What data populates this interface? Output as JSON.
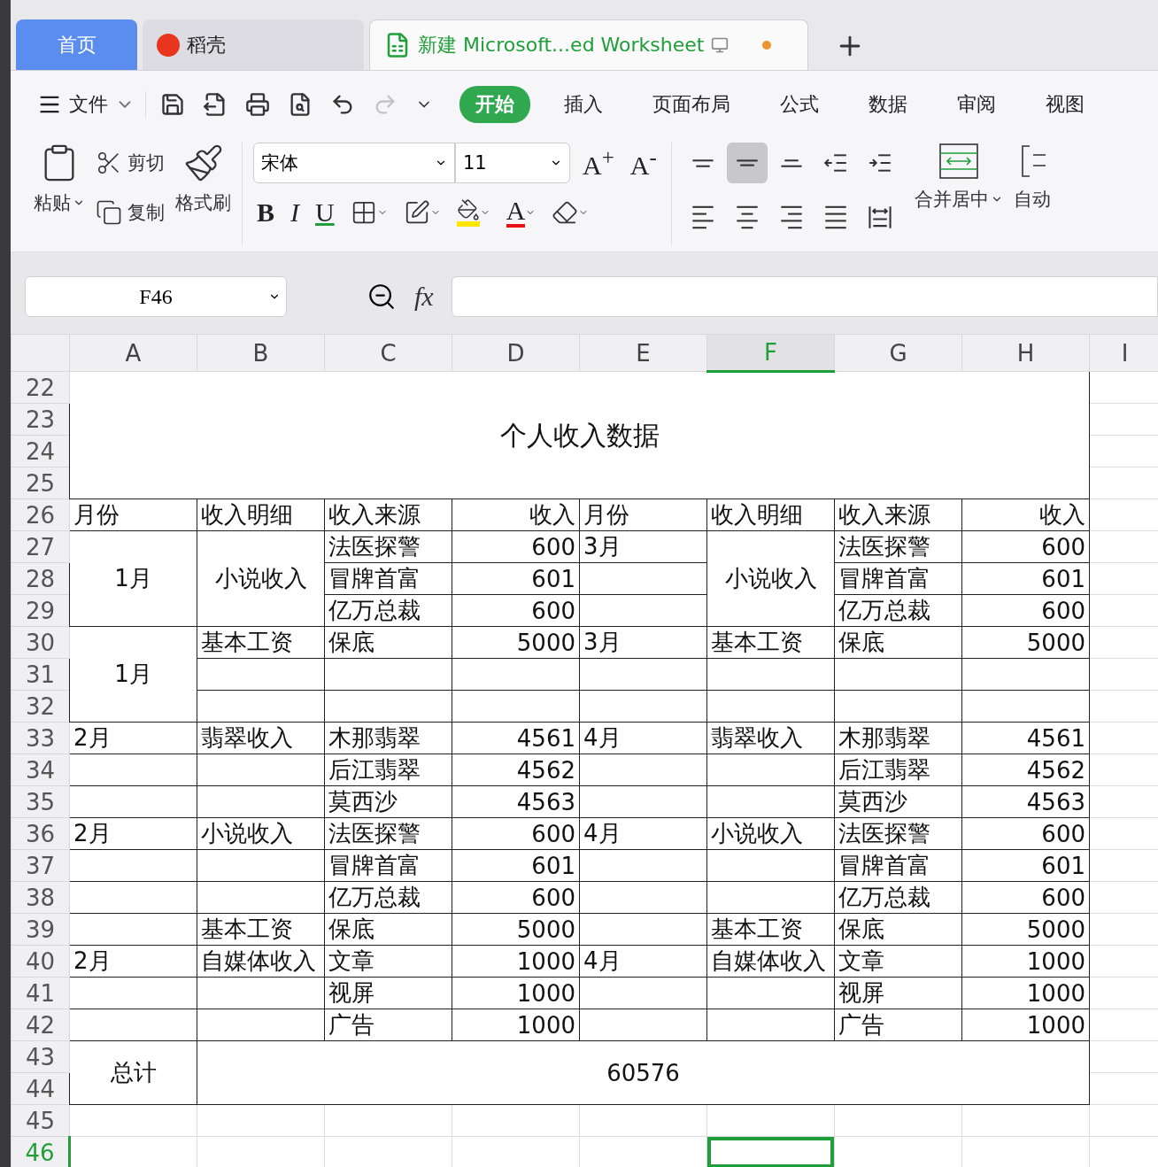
{
  "tabs": [
    {
      "label": "首页",
      "kind": "home",
      "selected": false
    },
    {
      "label": "稻壳",
      "kind": "docer",
      "selected": false
    },
    {
      "label": "新建 Microsoft...ed Worksheet",
      "kind": "sheet",
      "selected": true,
      "unsaved": true
    }
  ],
  "menu": {
    "file": "文件",
    "quick_access": [
      {
        "kind": "save",
        "disabled": false
      },
      {
        "kind": "export",
        "disabled": false
      },
      {
        "kind": "print",
        "disabled": false
      },
      {
        "kind": "preview",
        "disabled": false
      },
      {
        "kind": "undo",
        "disabled": false
      },
      {
        "kind": "redo",
        "disabled": true
      },
      {
        "kind": "more",
        "disabled": false
      }
    ],
    "tabs": [
      {
        "label": "开始",
        "selected": true
      },
      {
        "label": "插入",
        "selected": false
      },
      {
        "label": "页面布局",
        "selected": false
      },
      {
        "label": "公式",
        "selected": false
      },
      {
        "label": "数据",
        "selected": false
      },
      {
        "label": "审阅",
        "selected": false
      },
      {
        "label": "视图",
        "selected": false
      }
    ]
  },
  "ribbon": {
    "paste": "粘贴",
    "cut": "剪切",
    "copy": "复制",
    "format_painter": "格式刷",
    "font_name": "宋体",
    "font_size": "11",
    "grow": "A$^{+}$",
    "shrink": "A$^{-}$",
    "bold": "B",
    "italic": "I",
    "underline": "U",
    "font_color": "A",
    "align_buttons": [
      {
        "kind": "top",
        "selected": false
      },
      {
        "kind": "middle",
        "selected": true
      },
      {
        "kind": "bottom",
        "selected": false
      },
      {
        "kind": "outdent",
        "selected": false
      },
      {
        "kind": "indent",
        "selected": false
      },
      {
        "kind": "left",
        "selected": false
      },
      {
        "kind": "center",
        "selected": false
      },
      {
        "kind": "right",
        "selected": false
      },
      {
        "kind": "justify",
        "selected": false
      },
      {
        "kind": "distributed",
        "selected": false
      }
    ],
    "merge": "合并居中",
    "wrap": "自动"
  },
  "formula_bar": {
    "name_box": "F46",
    "fx": "fx"
  },
  "sheet": {
    "columns": [
      {
        "label": "A",
        "selected": false
      },
      {
        "label": "B",
        "selected": false
      },
      {
        "label": "C",
        "selected": false
      },
      {
        "label": "D",
        "selected": false
      },
      {
        "label": "E",
        "selected": false
      },
      {
        "label": "F",
        "selected": true
      },
      {
        "label": "G",
        "selected": false
      },
      {
        "label": "H",
        "selected": false
      },
      {
        "label": "I",
        "selected": false
      }
    ],
    "rows": [
      {
        "number": "22",
        "selected": false,
        "cells": [
          {
            "text": "个人收入数据",
            "rowspan": 4,
            "colspan": 8
          }
        ]
      },
      {
        "number": "23",
        "selected": false
      },
      {
        "number": "24",
        "selected": false
      },
      {
        "number": "25",
        "selected": false
      },
      {
        "number": "26",
        "selected": false,
        "cells": [
          {
            "text": "月份"
          },
          {
            "text": "收入明细"
          },
          {
            "text": "收入来源"
          },
          {
            "text": "收入"
          },
          {
            "text": "月份"
          },
          {
            "text": "收入明细"
          },
          {
            "text": "收入来源"
          },
          {
            "text": "收入"
          }
        ]
      },
      {
        "number": "27",
        "selected": false,
        "cells": [
          {
            "text": "1月",
            "rowspan": 3
          },
          {
            "text": "小说收入",
            "rowspan": 3
          },
          {
            "text": "法医探警"
          },
          {
            "text": "600"
          },
          {
            "text": "3月"
          },
          {
            "text": "小说收入",
            "rowspan": 3
          },
          {
            "text": "法医探警"
          },
          {
            "text": "600"
          }
        ]
      },
      {
        "number": "28",
        "selected": false,
        "cells": [
          {
            "text": "冒牌首富"
          },
          {
            "text": "601"
          },
          null,
          {
            "text": "冒牌首富"
          },
          {
            "text": "601"
          }
        ]
      },
      {
        "number": "29",
        "selected": false,
        "cells": [
          {
            "text": "亿万总裁"
          },
          {
            "text": "600"
          },
          null,
          {
            "text": "亿万总裁"
          },
          {
            "text": "600"
          }
        ]
      },
      {
        "number": "30",
        "selected": false,
        "cells": [
          {
            "text": "1月",
            "rowspan": 3
          },
          {
            "text": "基本工资"
          },
          {
            "text": "保底"
          },
          {
            "text": "5000"
          },
          {
            "text": "3月"
          },
          {
            "text": "基本工资"
          },
          {
            "text": "保底"
          },
          {
            "text": "5000"
          }
        ]
      },
      {
        "number": "31",
        "selected": false,
        "cells": [
          null,
          null,
          null,
          null,
          null,
          null,
          null
        ]
      },
      {
        "number": "32",
        "selected": false,
        "cells": [
          null,
          null,
          null,
          null,
          null,
          null,
          null
        ]
      },
      {
        "number": "33",
        "selected": false,
        "cells": [
          {
            "text": "2月"
          },
          {
            "text": "翡翠收入"
          },
          {
            "text": "木那翡翠"
          },
          {
            "text": "4561"
          },
          {
            "text": "4月"
          },
          {
            "text": "翡翠收入"
          },
          {
            "text": "木那翡翠"
          },
          {
            "text": "4561"
          }
        ]
      },
      {
        "number": "34",
        "selected": false,
        "cells": [
          null,
          null,
          {
            "text": "后江翡翠"
          },
          {
            "text": "4562"
          },
          null,
          null,
          {
            "text": "后江翡翠"
          },
          {
            "text": "4562"
          }
        ]
      },
      {
        "number": "35",
        "selected": false,
        "cells": [
          null,
          null,
          {
            "text": "莫西沙"
          },
          {
            "text": "4563"
          },
          null,
          null,
          {
            "text": "莫西沙"
          },
          {
            "text": "4563"
          }
        ]
      },
      {
        "number": "36",
        "selected": false,
        "cells": [
          {
            "text": "2月"
          },
          {
            "text": "小说收入"
          },
          {
            "text": "法医探警"
          },
          {
            "text": "600"
          },
          {
            "text": "4月"
          },
          {
            "text": "小说收入"
          },
          {
            "text": "法医探警"
          },
          {
            "text": "600"
          }
        ]
      },
      {
        "number": "37",
        "selected": false,
        "cells": [
          null,
          null,
          {
            "text": "冒牌首富"
          },
          {
            "text": "601"
          },
          null,
          null,
          {
            "text": "冒牌首富"
          },
          {
            "text": "601"
          }
        ]
      },
      {
        "number": "38",
        "selected": false,
        "cells": [
          null,
          null,
          {
            "text": "亿万总裁"
          },
          {
            "text": "600"
          },
          null,
          null,
          {
            "text": "亿万总裁"
          },
          {
            "text": "600"
          }
        ]
      },
      {
        "number": "39",
        "selected": false,
        "cells": [
          null,
          {
            "text": "基本工资"
          },
          {
            "text": "保底"
          },
          {
            "text": "5000"
          },
          null,
          {
            "text": "基本工资"
          },
          {
            "text": "保底"
          },
          {
            "text": "5000"
          }
        ]
      },
      {
        "number": "40",
        "selected": false,
        "cells": [
          {
            "text": "2月"
          },
          {
            "text": "自媒体收入"
          },
          {
            "text": "文章"
          },
          {
            "text": "1000"
          },
          {
            "text": "4月"
          },
          {
            "text": "自媒体收入"
          },
          {
            "text": "文章"
          },
          {
            "text": "1000"
          }
        ]
      },
      {
        "number": "41",
        "selected": false,
        "cells": [
          null,
          null,
          {
            "text": "视屏"
          },
          {
            "text": "1000"
          },
          null,
          null,
          {
            "text": "视屏"
          },
          {
            "text": "1000"
          }
        ]
      },
      {
        "number": "42",
        "selected": false,
        "cells": [
          null,
          null,
          {
            "text": "广告"
          },
          {
            "text": "1000"
          },
          null,
          null,
          {
            "text": "广告"
          },
          {
            "text": "1000"
          }
        ]
      },
      {
        "number": "43",
        "selected": false,
        "cells": [
          {
            "text": "总计",
            "rowspan": 2
          },
          {
            "text": "60576",
            "rowspan": 2,
            "colspan": 7
          }
        ]
      },
      {
        "number": "44",
        "selected": false
      },
      {
        "number": "45",
        "selected": false
      },
      {
        "number": "46",
        "selected": true
      }
    ]
  }
}
